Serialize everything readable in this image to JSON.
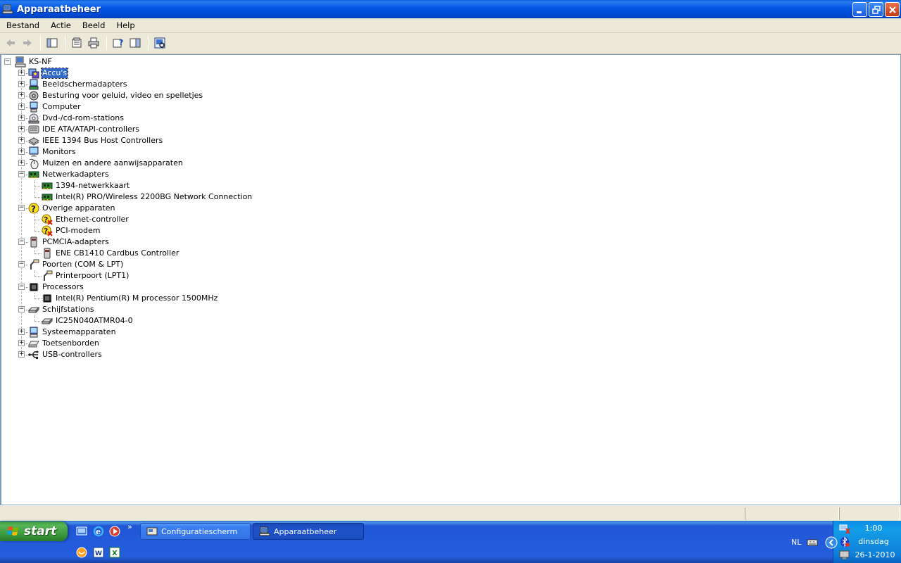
{
  "window": {
    "title": "Apparaatbeheer"
  },
  "menu": [
    "Bestand",
    "Actie",
    "Beeld",
    "Help"
  ],
  "tree": {
    "root": "KS-NF",
    "categories": [
      {
        "label": "Accu's",
        "expanded": false,
        "selected": true,
        "icon": "battery-icon",
        "children": []
      },
      {
        "label": "Beeldschermadapters",
        "expanded": false,
        "icon": "display-adapter-icon",
        "children": []
      },
      {
        "label": "Besturing voor geluid, video en spelletjes",
        "expanded": false,
        "icon": "sound-icon",
        "children": []
      },
      {
        "label": "Computer",
        "expanded": false,
        "icon": "computer-icon",
        "children": []
      },
      {
        "label": "Dvd-/cd-rom-stations",
        "expanded": false,
        "icon": "cdrom-icon",
        "children": []
      },
      {
        "label": "IDE ATA/ATAPI-controllers",
        "expanded": false,
        "icon": "ide-controller-icon",
        "children": []
      },
      {
        "label": "IEEE 1394 Bus Host Controllers",
        "expanded": false,
        "icon": "firewire-icon",
        "children": []
      },
      {
        "label": "Monitors",
        "expanded": false,
        "icon": "monitor-icon",
        "children": []
      },
      {
        "label": "Muizen en andere aanwijsapparaten",
        "expanded": false,
        "icon": "mouse-icon",
        "children": []
      },
      {
        "label": "Netwerkadapters",
        "expanded": true,
        "icon": "network-adapter-icon",
        "children": [
          {
            "label": "1394-netwerkkaart",
            "icon": "network-card-icon"
          },
          {
            "label": "Intel(R) PRO/Wireless 2200BG Network Connection",
            "icon": "network-card-icon"
          }
        ]
      },
      {
        "label": "Overige apparaten",
        "expanded": true,
        "icon": "unknown-device-icon",
        "children": [
          {
            "label": "Ethernet-controller",
            "icon": "warning-device-icon"
          },
          {
            "label": "PCI-modem",
            "icon": "warning-device-icon"
          }
        ]
      },
      {
        "label": "PCMCIA-adapters",
        "expanded": true,
        "icon": "pcmcia-icon",
        "children": [
          {
            "label": "ENE CB1410 Cardbus Controller",
            "icon": "pcmcia-icon"
          }
        ]
      },
      {
        "label": "Poorten (COM & LPT)",
        "expanded": true,
        "icon": "port-icon",
        "children": [
          {
            "label": "Printerpoort (LPT1)",
            "icon": "port-icon"
          }
        ]
      },
      {
        "label": "Processors",
        "expanded": true,
        "icon": "processor-icon",
        "children": [
          {
            "label": "Intel(R) Pentium(R) M processor 1500MHz",
            "icon": "processor-icon"
          }
        ]
      },
      {
        "label": "Schijfstations",
        "expanded": true,
        "icon": "disk-drive-icon",
        "children": [
          {
            "label": "IC25N040ATMR04-0",
            "icon": "disk-drive-icon"
          }
        ]
      },
      {
        "label": "Systeemapparaten",
        "expanded": false,
        "icon": "system-device-icon",
        "children": []
      },
      {
        "label": "Toetsenborden",
        "expanded": false,
        "icon": "keyboard-icon",
        "children": []
      },
      {
        "label": "USB-controllers",
        "expanded": false,
        "icon": "usb-icon",
        "children": []
      }
    ]
  },
  "taskbar": {
    "start_label": "start",
    "overflow_glyph": "»",
    "tasks": [
      {
        "label": "Configuratiescherm",
        "active": false
      },
      {
        "label": "Apparaatbeheer",
        "active": true
      }
    ],
    "tray": {
      "language": "NL",
      "time": "1:00",
      "day": "dinsdag",
      "date": "26-1-2010"
    }
  },
  "colors": {
    "titlebar": "#0055e5",
    "selection": "#316ac5",
    "taskbar": "#245edc",
    "start": "#3c9a3c"
  }
}
